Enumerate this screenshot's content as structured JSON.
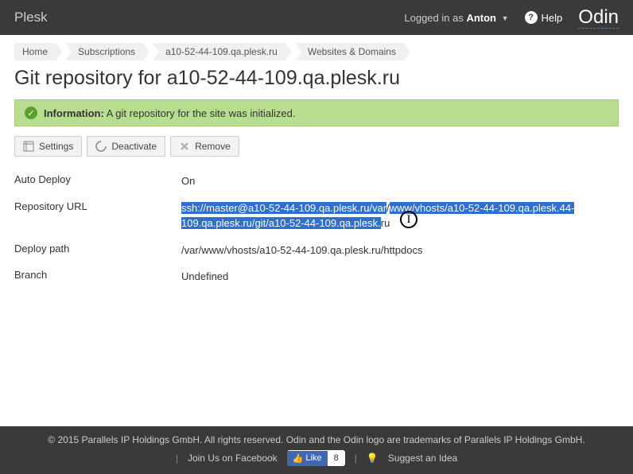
{
  "header": {
    "brand": "Plesk",
    "login_prefix": "Logged in as",
    "login_user": "Anton",
    "help": "Help",
    "partner_logo": "Odin"
  },
  "breadcrumbs": [
    "Home",
    "Subscriptions",
    "a10-52-44-109.qa.plesk.ru",
    "Websites & Domains"
  ],
  "page_title": "Git repository for a10-52-44-109.qa.plesk.ru",
  "info": {
    "label": "Information:",
    "message": " A git repository for the site was initialized."
  },
  "toolbar": {
    "settings": "Settings",
    "deactivate": "Deactivate",
    "remove": "Remove"
  },
  "details": {
    "auto_deploy_key": "Auto Deploy",
    "auto_deploy_val": "On",
    "repo_url_key": "Repository URL",
    "repo_url_part1": "ssh://master@a10-52-44-109.qa.plesk.ru/var",
    "repo_url_part2": "www/vhosts/a10-52-44-109.qa.plesk.",
    "repo_url_part3": "109.qa.plesk.ru/git/a10-52-44-109.qa.plesk.",
    "repo_url_tail_unselected": "ru",
    "deploy_path_key": "Deploy path",
    "deploy_path_val": "/var/www/vhosts/a10-52-44-109.qa.plesk.ru/httpdocs",
    "branch_key": "Branch",
    "branch_val": "Undefined"
  },
  "footer": {
    "copyright": "© 2015 Parallels IP Holdings GmbH. All rights reserved. Odin and the Odin logo are trademarks of Parallels IP Holdings GmbH.",
    "join_fb": "Join Us on Facebook",
    "like": "Like",
    "like_count": "8",
    "suggest": "Suggest an Idea"
  }
}
